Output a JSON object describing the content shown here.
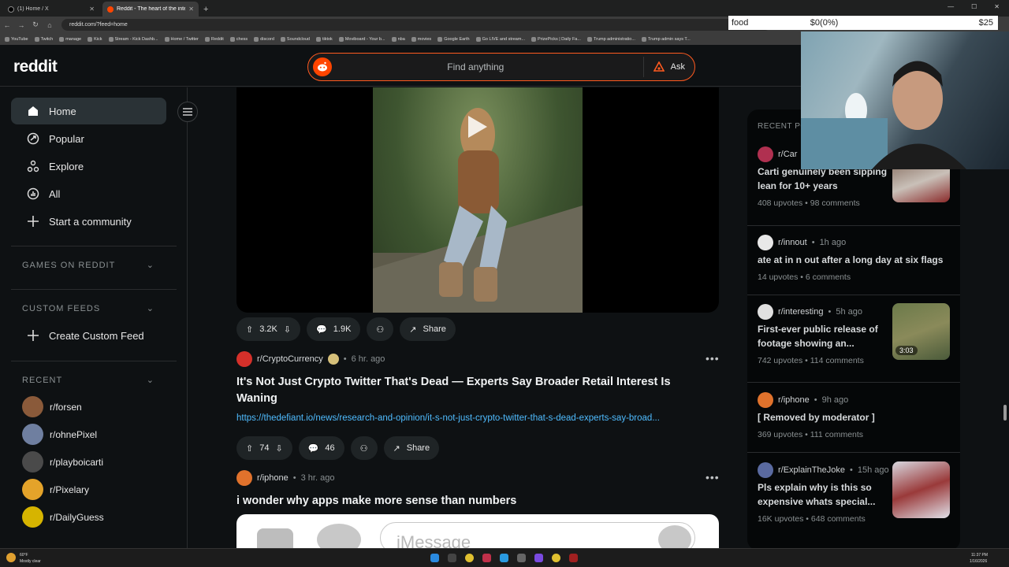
{
  "browser": {
    "tabs": [
      {
        "title": "(1) Home / X",
        "active": false
      },
      {
        "title": "Reddit - The heart of the intern",
        "active": true
      }
    ],
    "new_tab": "+",
    "url": "reddit.com/?feed=home",
    "bookmarks": [
      "YouTube",
      "Twitch",
      "manage",
      "Kick",
      "Stream - Kick Dashb...",
      "Home / Twitter",
      "Reddit",
      "chess",
      "discord",
      "Soundcloud",
      "tiktok",
      "Moviboard - Your b...",
      "nba",
      "movies",
      "Google Earth",
      "Go LIVE and stream...",
      "PrizePicks | Daily Fa...",
      "Trump administratio...",
      "Trump admin says T..."
    ]
  },
  "portfolio": {
    "label": "food",
    "change": "$0(0%)",
    "value": "$25"
  },
  "header": {
    "logo": "reddit",
    "search_placeholder": "Find anything",
    "ask_label": "Ask"
  },
  "sidebar": {
    "nav": [
      {
        "label": "Home",
        "icon": "home-icon",
        "active": true
      },
      {
        "label": "Popular",
        "icon": "popular-icon"
      },
      {
        "label": "Explore",
        "icon": "explore-icon"
      },
      {
        "label": "All",
        "icon": "all-icon"
      },
      {
        "label": "Start a community",
        "icon": "plus-icon"
      }
    ],
    "games_label": "GAMES ON REDDIT",
    "custom_feeds_label": "CUSTOM FEEDS",
    "create_feed_label": "Create Custom Feed",
    "recent_label": "RECENT",
    "recent": [
      {
        "name": "r/forsen",
        "color": "#8a5a3a"
      },
      {
        "name": "r/ohnePixel",
        "color": "#6f7fa0"
      },
      {
        "name": "r/playboicarti",
        "color": "#4a4a4a"
      },
      {
        "name": "r/Pixelary",
        "color": "#e4a32a"
      },
      {
        "name": "r/DailyGuess",
        "color": "#d6b400"
      }
    ]
  },
  "feed": {
    "post1": {
      "upvotes": "3.2K",
      "comments": "1.9K",
      "share": "Share"
    },
    "post2": {
      "subreddit": "r/CryptoCurrency",
      "age": "6 hr. ago",
      "title": "It's Not Just Crypto Twitter That's Dead — Experts Say Broader Retail Interest Is Waning",
      "link": "https://thedefiant.io/news/research-and-opinion/it-s-not-just-crypto-twitter-that-s-dead-experts-say-broad...",
      "upvotes": "74",
      "comments": "46",
      "share": "Share"
    },
    "post3": {
      "subreddit": "r/iphone",
      "age": "3 hr. ago",
      "title": "i wonder why apps make more sense than numbers",
      "image_placeholder": "iMessage"
    }
  },
  "recent_posts": {
    "title": "RECENT PO",
    "items": [
      {
        "subreddit": "r/Car",
        "age": "",
        "title": "Carti genuinely been sipping lean for 10+ years",
        "upvotes": "408 upvotes",
        "comments": "98 comments",
        "thumb": true
      },
      {
        "subreddit": "r/innout",
        "age": "1h ago",
        "title": "ate at in n out after a long day at six flags",
        "upvotes": "14 upvotes",
        "comments": "6 comments",
        "thumb": false
      },
      {
        "subreddit": "r/interesting",
        "age": "5h ago",
        "title": "First-ever public release of footage showing an...",
        "upvotes": "742 upvotes",
        "comments": "114 comments",
        "thumb": true,
        "duration": "3:03"
      },
      {
        "subreddit": "r/iphone",
        "age": "9h ago",
        "title": "[ Removed by moderator ]",
        "upvotes": "369 upvotes",
        "comments": "111 comments",
        "thumb": false
      },
      {
        "subreddit": "r/ExplainTheJoke",
        "age": "15h ago",
        "title": "Pls explain why is this so expensive whats special...",
        "upvotes": "16K upvotes",
        "comments": "648 comments",
        "thumb": true
      }
    ]
  },
  "taskbar": {
    "weather_temp": "60°F",
    "weather_text": "Mostly clear",
    "time": "11:37 PM",
    "date": "1/16/2026"
  },
  "colors": {
    "accent": "#ff4500",
    "link": "#4fbcff",
    "bg": "#0e1113"
  }
}
